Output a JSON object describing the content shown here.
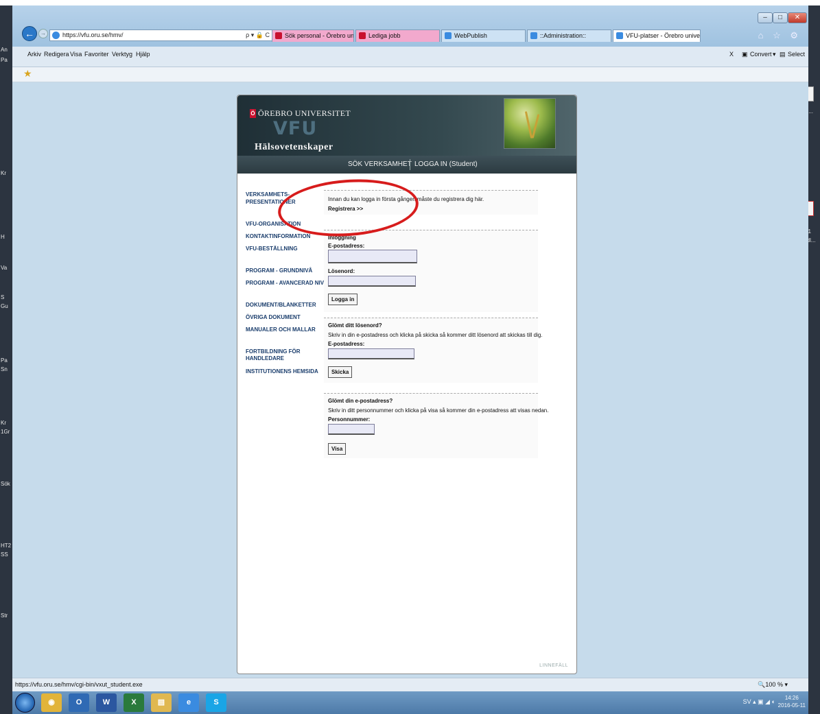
{
  "desktop": {
    "left_fragments": [
      "An",
      "Pa",
      "Kr",
      "H",
      "Va",
      "S",
      "Gu",
      "Pa",
      "Sn",
      "Kr",
      "1Gr",
      "Sök",
      "HT2",
      "SS",
      "Str"
    ],
    "right_fragments": [
      "sättn...",
      "B.721",
      "Handl..."
    ]
  },
  "browser": {
    "address_url": "https://vfu.oru.se/hmv/",
    "address_tools": "ρ ▾ 🔒 C",
    "tabs": [
      {
        "label": "Sök personal - Örebro universi...",
        "color": "#f2a9cd",
        "icon": "oru-icon"
      },
      {
        "label": "Lediga jobb",
        "color": "#f2a9cd",
        "icon": "oru-icon"
      },
      {
        "label": "WebPublish",
        "color": "#cde2f4",
        "icon": "ie-icon"
      },
      {
        "label": "::Administration::",
        "color": "#cde2f4",
        "icon": "ie-icon"
      },
      {
        "label": "VFU-platser - Örebro univer...",
        "color": "#ffffff",
        "icon": "ie-icon",
        "close": "×"
      }
    ],
    "window_buttons": {
      "minimize": "‒",
      "maximize": "□",
      "close": "✕"
    },
    "right_icons": "⌂ ☆ ⚙",
    "menu": [
      "Arkiv",
      "Redigera",
      "Visa",
      "Favoriter",
      "Verktyg",
      "Hjälp"
    ],
    "convert_close": "X",
    "convert_label": "Convert",
    "convert_arrow": "▾",
    "select_label": "Select",
    "favorites_icon": "★",
    "status_url": "https://vfu.oru.se/hmv/cgi-bin/vxut_student.exe",
    "zoom": "100 %",
    "zoom_arrow": "▾"
  },
  "site": {
    "university_name": "ÖREBRO UNIVERSITET",
    "university_badge": "Ö",
    "title": "VFU",
    "department": "Hälsovetenskaper",
    "topnav": [
      "SÖK VERKSAMHET",
      "LOGGA IN (Student)"
    ],
    "sidenav": [
      "VERKSAMHETS-",
      "PRESENTATIONER",
      "VFU-ORGANISATION",
      "KONTAKTINFORMATION",
      "VFU-BESTÄLLNING",
      "PROGRAM - GRUNDNIVÅ",
      "PROGRAM - AVANCERAD NIVÅ",
      "DOKUMENT/BLANKETTER",
      "ÖVRIGA DOKUMENT",
      "MANUALER OCH MALLAR",
      "FORTBILDNING FÖR",
      "HANDLEDARE",
      "INSTITUTIONENS HEMSIDA"
    ],
    "register": {
      "text": "Innan du kan logga in första gången måste du registrera dig här.",
      "link": "Registrera >>"
    },
    "login": {
      "title": "Inloggning",
      "email_label": "E-postadress:",
      "email_value": "",
      "password_label": "Lösenord:",
      "password_value": "",
      "button": "Logga in"
    },
    "forgot_password": {
      "title": "Glömt ditt lösenord?",
      "text": "Skriv in din e-postadress och klicka på skicka så kommer ditt lösenord att skickas till dig.",
      "email_label": "E-postadress:",
      "email_value": "",
      "button": "Skicka"
    },
    "forgot_email": {
      "title": "Glömt din e-postadress?",
      "text": "Skriv in ditt personnummer och klicka på visa så kommer din e-postadress att visas nedan.",
      "pnr_label": "Personnummer:",
      "pnr_value": "",
      "button": "Visa"
    },
    "footer": "LINNEFÄLL"
  },
  "taskbar": {
    "apps": [
      {
        "name": "chrome",
        "label": "◉",
        "color": "#e2b43a"
      },
      {
        "name": "outlook",
        "label": "O",
        "color": "#2f6ab4"
      },
      {
        "name": "word",
        "label": "W",
        "color": "#2b57a0"
      },
      {
        "name": "excel",
        "label": "X",
        "color": "#2a7a3c"
      },
      {
        "name": "explorer",
        "label": "▤",
        "color": "#e0b850"
      },
      {
        "name": "internet-explorer",
        "label": "e",
        "color": "#3a8be0"
      },
      {
        "name": "skype",
        "label": "S",
        "color": "#1aa5e6"
      }
    ],
    "tray": "SV ▴ ▣ ◢ ◐",
    "time": "14:26",
    "date": "2016-05-11"
  }
}
